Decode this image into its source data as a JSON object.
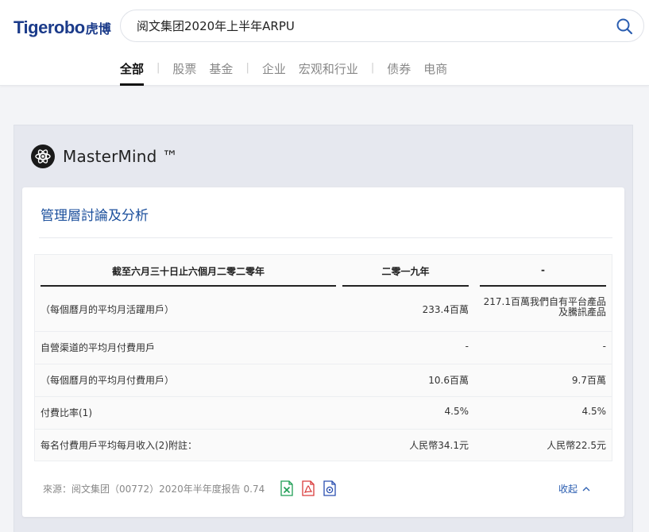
{
  "brand": {
    "name_en": "Tigerobo",
    "name_cn": "虎博"
  },
  "search": {
    "query": "阅文集团2020年上半年ARPU"
  },
  "tabs": [
    "全部",
    "股票",
    "基金",
    "企业",
    "宏观和行业",
    "债券",
    "电商"
  ],
  "active_tab": "全部",
  "panel": {
    "title": "MasterMind ™"
  },
  "card": {
    "title": "管理層討論及分析",
    "table": {
      "headers": [
        "截至六月三十日止六個月二零二零年",
        "二零一九年",
        "-"
      ],
      "rows": [
        {
          "label": "（每個曆月的平均月活躍用戶）",
          "v1": "233.4百萬",
          "v2": "217.1百萬我們自有平台產品及騰訊產品"
        },
        {
          "label": "自營渠道的平均月付費用戶",
          "v1": "-",
          "v2": "-"
        },
        {
          "label": "（每個曆月的平均月付費用戶）",
          "v1": "10.6百萬",
          "v2": "9.7百萬"
        },
        {
          "label": "付費比率(1)",
          "v1": "4.5%",
          "v2": "4.5%"
        },
        {
          "label": "每名付費用戶平均每月收入(2)附註：",
          "v1": "人民幣34.1元",
          "v2": "人民幣22.5元"
        }
      ]
    },
    "source": "來源：阅文集团（00772）2020年半年度报告 0.74",
    "file_icons": [
      "excel-icon",
      "pdf-icon",
      "snapshot-icon"
    ],
    "collapse_label": "收起"
  },
  "colors": {
    "brand": "#1b3b8a",
    "link": "#2a5db0",
    "title": "#1b4f9c",
    "excel": "#1f9d55",
    "pdf": "#d93b3b",
    "snapshot": "#2a4fb0"
  }
}
